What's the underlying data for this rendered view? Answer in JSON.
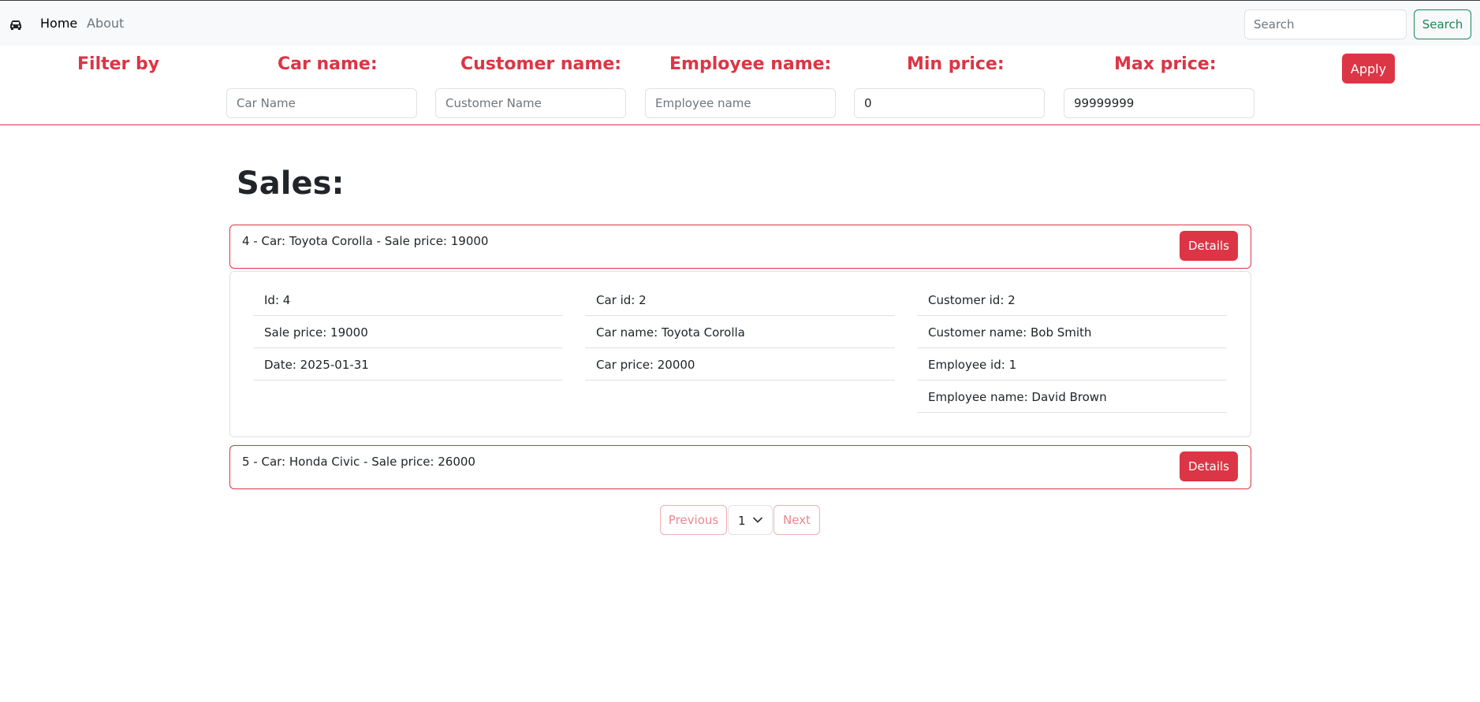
{
  "nav": {
    "brand_icon": "car-icon",
    "links": [
      {
        "label": "Home"
      },
      {
        "label": "About"
      }
    ],
    "search": {
      "placeholder": "Search",
      "button_label": "Search"
    }
  },
  "filters": {
    "title": "Filter by",
    "fields": [
      {
        "label": "Car name:",
        "placeholder": "Car Name",
        "value": ""
      },
      {
        "label": "Customer name:",
        "placeholder": "Customer Name",
        "value": ""
      },
      {
        "label": "Employee name:",
        "placeholder": "Employee name",
        "value": ""
      },
      {
        "label": "Min price:",
        "placeholder": "",
        "value": "0"
      },
      {
        "label": "Max price:",
        "placeholder": "",
        "value": "99999999"
      }
    ],
    "apply_label": "Apply"
  },
  "main": {
    "title": "Sales:",
    "sales": [
      {
        "label": "4 - Car: Toyota Corolla - Sale price: 19000",
        "button_label": "Details"
      },
      {
        "label": "5 - Car: Honda Civic - Sale price: 26000",
        "button_label": "Details"
      }
    ],
    "details": {
      "col1": [
        "Id: 4",
        "Sale price: 19000",
        "Date: 2025-01-31"
      ],
      "col2": [
        "Car id: 2",
        "Car name: Toyota Corolla",
        "Car price: 20000"
      ],
      "col3": [
        "Customer id: 2",
        "Customer name: Bob Smith",
        "Employee id: 1",
        "Employee name: David Brown"
      ]
    }
  },
  "pagination": {
    "prev_label": "Previous",
    "current_page": "1",
    "next_label": "Next"
  },
  "colors": {
    "accent": "#dc3545",
    "success": "#198754",
    "navbar_bg": "#f8f9fa"
  }
}
